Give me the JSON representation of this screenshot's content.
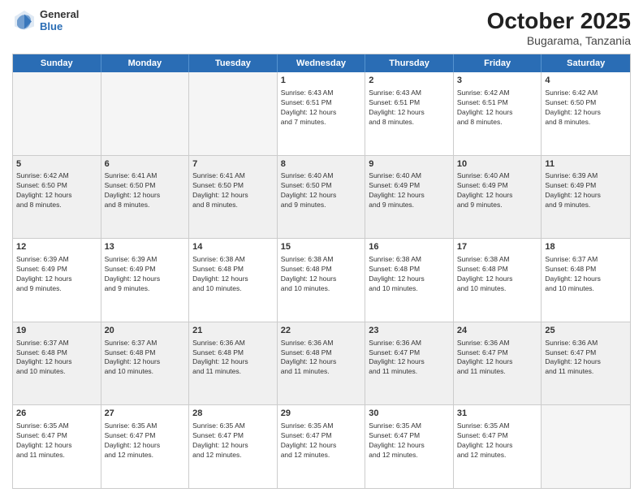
{
  "header": {
    "logo": {
      "general": "General",
      "blue": "Blue"
    },
    "title": "October 2025",
    "subtitle": "Bugarama, Tanzania"
  },
  "calendar": {
    "days": [
      "Sunday",
      "Monday",
      "Tuesday",
      "Wednesday",
      "Thursday",
      "Friday",
      "Saturday"
    ],
    "rows": [
      [
        {
          "day": "",
          "empty": true
        },
        {
          "day": "",
          "empty": true
        },
        {
          "day": "",
          "empty": true
        },
        {
          "day": "1",
          "lines": [
            "Sunrise: 6:43 AM",
            "Sunset: 6:51 PM",
            "Daylight: 12 hours",
            "and 7 minutes."
          ]
        },
        {
          "day": "2",
          "lines": [
            "Sunrise: 6:43 AM",
            "Sunset: 6:51 PM",
            "Daylight: 12 hours",
            "and 8 minutes."
          ]
        },
        {
          "day": "3",
          "lines": [
            "Sunrise: 6:42 AM",
            "Sunset: 6:51 PM",
            "Daylight: 12 hours",
            "and 8 minutes."
          ]
        },
        {
          "day": "4",
          "lines": [
            "Sunrise: 6:42 AM",
            "Sunset: 6:50 PM",
            "Daylight: 12 hours",
            "and 8 minutes."
          ]
        }
      ],
      [
        {
          "day": "5",
          "lines": [
            "Sunrise: 6:42 AM",
            "Sunset: 6:50 PM",
            "Daylight: 12 hours",
            "and 8 minutes."
          ]
        },
        {
          "day": "6",
          "lines": [
            "Sunrise: 6:41 AM",
            "Sunset: 6:50 PM",
            "Daylight: 12 hours",
            "and 8 minutes."
          ]
        },
        {
          "day": "7",
          "lines": [
            "Sunrise: 6:41 AM",
            "Sunset: 6:50 PM",
            "Daylight: 12 hours",
            "and 8 minutes."
          ]
        },
        {
          "day": "8",
          "lines": [
            "Sunrise: 6:40 AM",
            "Sunset: 6:50 PM",
            "Daylight: 12 hours",
            "and 9 minutes."
          ]
        },
        {
          "day": "9",
          "lines": [
            "Sunrise: 6:40 AM",
            "Sunset: 6:49 PM",
            "Daylight: 12 hours",
            "and 9 minutes."
          ]
        },
        {
          "day": "10",
          "lines": [
            "Sunrise: 6:40 AM",
            "Sunset: 6:49 PM",
            "Daylight: 12 hours",
            "and 9 minutes."
          ]
        },
        {
          "day": "11",
          "lines": [
            "Sunrise: 6:39 AM",
            "Sunset: 6:49 PM",
            "Daylight: 12 hours",
            "and 9 minutes."
          ]
        }
      ],
      [
        {
          "day": "12",
          "lines": [
            "Sunrise: 6:39 AM",
            "Sunset: 6:49 PM",
            "Daylight: 12 hours",
            "and 9 minutes."
          ]
        },
        {
          "day": "13",
          "lines": [
            "Sunrise: 6:39 AM",
            "Sunset: 6:49 PM",
            "Daylight: 12 hours",
            "and 9 minutes."
          ]
        },
        {
          "day": "14",
          "lines": [
            "Sunrise: 6:38 AM",
            "Sunset: 6:48 PM",
            "Daylight: 12 hours",
            "and 10 minutes."
          ]
        },
        {
          "day": "15",
          "lines": [
            "Sunrise: 6:38 AM",
            "Sunset: 6:48 PM",
            "Daylight: 12 hours",
            "and 10 minutes."
          ]
        },
        {
          "day": "16",
          "lines": [
            "Sunrise: 6:38 AM",
            "Sunset: 6:48 PM",
            "Daylight: 12 hours",
            "and 10 minutes."
          ]
        },
        {
          "day": "17",
          "lines": [
            "Sunrise: 6:38 AM",
            "Sunset: 6:48 PM",
            "Daylight: 12 hours",
            "and 10 minutes."
          ]
        },
        {
          "day": "18",
          "lines": [
            "Sunrise: 6:37 AM",
            "Sunset: 6:48 PM",
            "Daylight: 12 hours",
            "and 10 minutes."
          ]
        }
      ],
      [
        {
          "day": "19",
          "lines": [
            "Sunrise: 6:37 AM",
            "Sunset: 6:48 PM",
            "Daylight: 12 hours",
            "and 10 minutes."
          ]
        },
        {
          "day": "20",
          "lines": [
            "Sunrise: 6:37 AM",
            "Sunset: 6:48 PM",
            "Daylight: 12 hours",
            "and 10 minutes."
          ]
        },
        {
          "day": "21",
          "lines": [
            "Sunrise: 6:36 AM",
            "Sunset: 6:48 PM",
            "Daylight: 12 hours",
            "and 11 minutes."
          ]
        },
        {
          "day": "22",
          "lines": [
            "Sunrise: 6:36 AM",
            "Sunset: 6:48 PM",
            "Daylight: 12 hours",
            "and 11 minutes."
          ]
        },
        {
          "day": "23",
          "lines": [
            "Sunrise: 6:36 AM",
            "Sunset: 6:47 PM",
            "Daylight: 12 hours",
            "and 11 minutes."
          ]
        },
        {
          "day": "24",
          "lines": [
            "Sunrise: 6:36 AM",
            "Sunset: 6:47 PM",
            "Daylight: 12 hours",
            "and 11 minutes."
          ]
        },
        {
          "day": "25",
          "lines": [
            "Sunrise: 6:36 AM",
            "Sunset: 6:47 PM",
            "Daylight: 12 hours",
            "and 11 minutes."
          ]
        }
      ],
      [
        {
          "day": "26",
          "lines": [
            "Sunrise: 6:35 AM",
            "Sunset: 6:47 PM",
            "Daylight: 12 hours",
            "and 11 minutes."
          ]
        },
        {
          "day": "27",
          "lines": [
            "Sunrise: 6:35 AM",
            "Sunset: 6:47 PM",
            "Daylight: 12 hours",
            "and 12 minutes."
          ]
        },
        {
          "day": "28",
          "lines": [
            "Sunrise: 6:35 AM",
            "Sunset: 6:47 PM",
            "Daylight: 12 hours",
            "and 12 minutes."
          ]
        },
        {
          "day": "29",
          "lines": [
            "Sunrise: 6:35 AM",
            "Sunset: 6:47 PM",
            "Daylight: 12 hours",
            "and 12 minutes."
          ]
        },
        {
          "day": "30",
          "lines": [
            "Sunrise: 6:35 AM",
            "Sunset: 6:47 PM",
            "Daylight: 12 hours",
            "and 12 minutes."
          ]
        },
        {
          "day": "31",
          "lines": [
            "Sunrise: 6:35 AM",
            "Sunset: 6:47 PM",
            "Daylight: 12 hours",
            "and 12 minutes."
          ]
        },
        {
          "day": "",
          "empty": true
        }
      ]
    ]
  }
}
